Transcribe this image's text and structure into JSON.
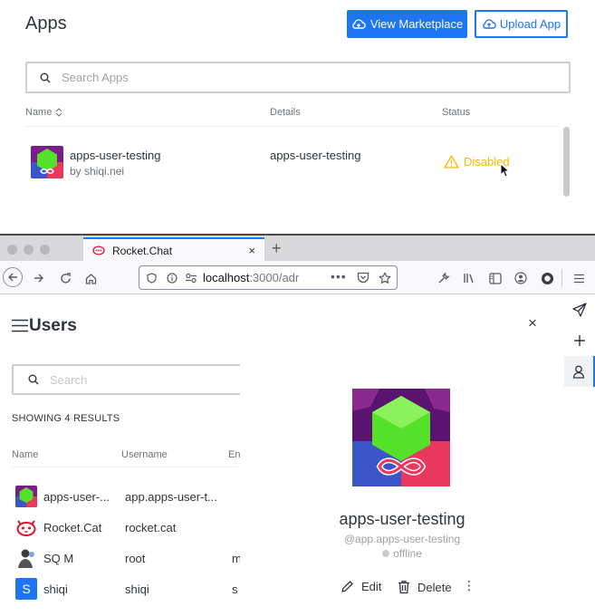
{
  "apps_panel": {
    "title": "Apps",
    "view_marketplace_label": "View Marketplace",
    "upload_app_label": "Upload App",
    "search_placeholder": "Search Apps",
    "columns": {
      "name": "Name",
      "details": "Details",
      "status": "Status"
    },
    "rows": [
      {
        "name": "apps-user-testing",
        "author": "by shiqi.nei",
        "details": "apps-user-testing",
        "status": "Disabled"
      }
    ]
  },
  "browser": {
    "tab_title": "Rocket.Chat",
    "url_host": "localhost",
    "url_rest": ":3000/adr",
    "new_tab_label": "+",
    "tab_close_label": "×"
  },
  "users_panel": {
    "title": "Users",
    "search_placeholder": "Search",
    "results_label": "SHOWING 4 RESULTS",
    "columns": {
      "name": "Name",
      "username": "Username",
      "email": "En"
    },
    "rows": [
      {
        "name": "apps-user-...",
        "username": "app.apps-user-t...",
        "email": ""
      },
      {
        "name": "Rocket.Cat",
        "username": "rocket.cat",
        "email": ""
      },
      {
        "name": "SQ M",
        "username": "root",
        "email": "m"
      },
      {
        "name": "shiqi",
        "username": "shiqi",
        "email": "s",
        "avatar_letter": "S"
      }
    ]
  },
  "user_info": {
    "name": "apps-user-testing",
    "username": "@app.apps-user-testing",
    "status": "offline",
    "edit_label": "Edit",
    "delete_label": "Delete",
    "close_label": "×",
    "more_label": "⋮"
  },
  "colors": {
    "primary": "#1d74f5",
    "warning": "#f5b800",
    "text": "#2f343d",
    "muted": "#9ea2a8"
  }
}
